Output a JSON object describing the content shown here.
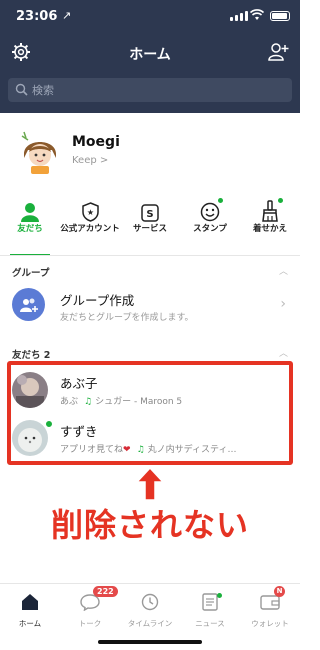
{
  "status": {
    "time": "23:06",
    "location_arrow": "↗"
  },
  "nav": {
    "title": "ホーム"
  },
  "search": {
    "placeholder": "検索"
  },
  "profile": {
    "name": "Moegi",
    "keep": "Keep >"
  },
  "tabs": [
    {
      "label": "友だち",
      "icon": "person-icon",
      "active": true
    },
    {
      "label": "公式アカウント",
      "icon": "official-account-icon"
    },
    {
      "label": "サービス",
      "icon": "service-icon"
    },
    {
      "label": "スタンプ",
      "icon": "sticker-icon",
      "dot": true
    },
    {
      "label": "着せかえ",
      "icon": "theme-brush-icon",
      "dot": true
    }
  ],
  "groups_section": {
    "label": "グループ",
    "create_title": "グループ作成",
    "create_desc": "友だちとグループを作成します。"
  },
  "friends_section": {
    "label": "友だち 2"
  },
  "friends": [
    {
      "name": "あぶ子",
      "status": "あぶ",
      "music": "シュガー - Maroon 5"
    },
    {
      "name": "すずき",
      "status": "アプリオ見てね",
      "music": "丸ノ内サディスティ…"
    }
  ],
  "caption": "削除されない",
  "bottom_nav": [
    {
      "label": "ホーム",
      "active": true
    },
    {
      "label": "トーク",
      "badge": "222"
    },
    {
      "label": "タイムライン"
    },
    {
      "label": "ニュース"
    },
    {
      "label": "ウォレット",
      "badge": "N"
    }
  ],
  "colors": {
    "header": "#2d3850",
    "accent": "#1ab03c",
    "highlight": "#e53323"
  }
}
